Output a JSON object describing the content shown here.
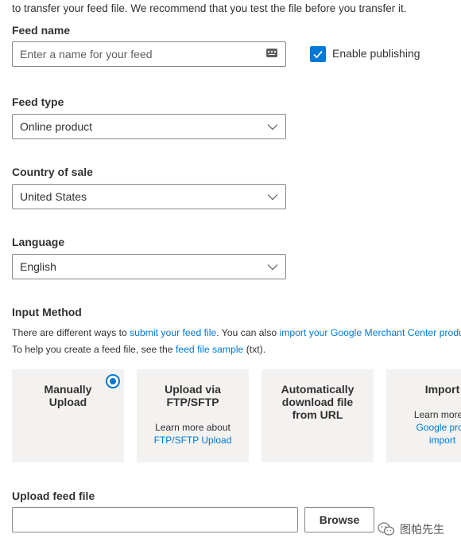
{
  "intro_text": "to transfer your feed file. We recommend that you test the file before you transfer it.",
  "feed_name": {
    "label": "Feed name",
    "placeholder": "Enter a name for your feed",
    "icon": "keyboard-icon"
  },
  "enable_publishing": {
    "label": "Enable publishing",
    "checked": true
  },
  "feed_type": {
    "label": "Feed type",
    "value": "Online product"
  },
  "country_of_sale": {
    "label": "Country of sale",
    "value": "United States"
  },
  "language": {
    "label": "Language",
    "value": "English"
  },
  "input_method": {
    "label": "Input Method",
    "line1": {
      "text1": "There are different ways to ",
      "link1": "submit your feed file",
      "text2": ". You can also ",
      "link2": "import your Google Merchant Center produc"
    },
    "line2": {
      "text1": "To help you create a feed file, see the ",
      "link1": "feed file sample",
      "text2": " (txt)."
    },
    "cards": [
      {
        "title": "Manually\nUpload",
        "selected": true
      },
      {
        "title": "Upload via\nFTP/SFTP",
        "sub": "Learn more about",
        "link": "FTP/SFTP Upload"
      },
      {
        "title": "Automatically\ndownload file\nfrom URL"
      },
      {
        "title": "Import",
        "sub": "Learn more a",
        "link1": "Google prod",
        "link2": "import"
      }
    ]
  },
  "upload": {
    "label": "Upload feed file",
    "value": "",
    "browse_label": "Browse"
  },
  "watermark": "图帕先生",
  "colors": {
    "accent": "#0078d4",
    "card_bg": "#f3f2f1",
    "border": "#8a8886",
    "text": "#323130"
  }
}
